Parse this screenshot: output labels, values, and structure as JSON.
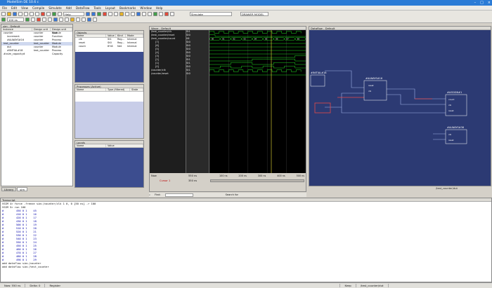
{
  "window": {
    "title": "ModelSim DE 10.6 c",
    "controls": [
      "–",
      "□",
      "×"
    ]
  },
  "menu": [
    "File",
    "Edit",
    "View",
    "Compile",
    "Simulate",
    "Add",
    "DataFlow",
    "Tools",
    "Layout",
    "Bookmarks",
    "Window",
    "Help"
  ],
  "toolbar": {
    "help_combo": "Help",
    "layout_combo": "Simulate",
    "time_field": "100 ns",
    "combo_right": "DRAWER MODEL"
  },
  "sim_panel": {
    "title": "sim - Default",
    "columns": [
      "Instance",
      "Design unit",
      "Design unit type"
    ],
    "rows": [
      {
        "name": "counter",
        "unit": "counter",
        "type": "Module"
      },
      {
        "name": "increment",
        "unit": "counter",
        "type": "Function"
      },
      {
        "name": "#ALWAYS#16",
        "unit": "counter",
        "type": "Process"
      },
      {
        "name": "test_counter",
        "unit": "test_counter",
        "type": "Module"
      },
      {
        "name": "dut",
        "unit": "counter",
        "type": "Module"
      },
      {
        "name": "#INITIAL#18",
        "unit": "test_counter",
        "type": "Process"
      },
      {
        "name": "#vsim_capacity#",
        "unit": "",
        "type": "Capacity"
      }
    ],
    "tabs": [
      "Library",
      "sim"
    ]
  },
  "objects_panel": {
    "title": "Objects",
    "columns": [
      "Name",
      "Value",
      "Kind",
      "Mode"
    ],
    "rows": [
      {
        "name": "clk",
        "value": "St1",
        "kind": "Reg...",
        "mode": "Internal"
      },
      {
        "name": "reset",
        "value": "St0",
        "kind": "Reg...",
        "mode": "Internal"
      },
      {
        "name": "count",
        "value": "8'h6",
        "kind": "Net",
        "mode": "Internal"
      }
    ]
  },
  "processes_panel": {
    "title": "Processes (Active)",
    "columns": [
      "Name",
      "Type (filtered)",
      "State"
    ]
  },
  "locals_panel": {
    "title": "Locals",
    "columns": [
      "Name",
      "Value"
    ]
  },
  "wave_panel": {
    "title": "Wave - Default",
    "signals": [
      {
        "name": "/test_counter/clk",
        "value": "St1"
      },
      {
        "name": "/test_counter/reset",
        "value": "St0"
      },
      {
        "name": "/test_counter/count",
        "value": "06"
      },
      {
        "name": "[7]",
        "value": "St0"
      },
      {
        "name": "[6]",
        "value": "St0"
      },
      {
        "name": "[5]",
        "value": "St0"
      },
      {
        "name": "[4]",
        "value": "St0"
      },
      {
        "name": "[3]",
        "value": "St0"
      },
      {
        "name": "[2]",
        "value": "St1"
      },
      {
        "name": "[1]",
        "value": "St1"
      },
      {
        "name": "[0]",
        "value": "St0"
      },
      {
        "name": "/counter/clk",
        "value": "St1"
      },
      {
        "name": "/counter/reset",
        "value": "St0"
      }
    ],
    "bus_values": [
      "00",
      "01",
      "02",
      "03",
      "04",
      "05",
      "06",
      "07",
      "08"
    ],
    "now_label": "Now",
    "now_value": "550 ns",
    "cursor_label": "Cursor 1",
    "cursor_value": "350 ns",
    "timeline": [
      "100 ns",
      "200 ns",
      "300 ns",
      "400 ns",
      "500 ns"
    ],
    "find_label": "Find:",
    "search_label": "Search for"
  },
  "dataflow_panel": {
    "title": "Dataflow - Default",
    "blocks": [
      {
        "title": "#INITIAL#18",
        "ports": []
      },
      {
        "title": "#ALWAYS#16",
        "ports": [
          "reset",
          "clk"
        ]
      },
      {
        "title": "#ASSIGN#1",
        "ports": [
          "count",
          "clk",
          "reset"
        ]
      },
      {
        "title": "#ALWAYS#36",
        "ports": [
          "clk",
          "reset"
        ]
      }
    ],
    "instance_label": "/test_counter/dut"
  },
  "transcript": {
    "title": "Transcript",
    "lines": [
      "VSIM 4> force -freeze sim:/counter/clk 1 0, 0 {50 ns} -r 100",
      "VSIM 5> run 100",
      "#        450 0 1    45",
      "#        410 0 1    16",
      "#        420 0 1    17",
      "#        430 0 1    18",
      "#        500 0 1    19",
      "#        510 0 1    20",
      "#        520 0 1    21",
      "#        530 0 1    22",
      "#        540 0 1    23",
      "#        550 0 1    24",
      "#        450 0 1    25",
      "#        460 0 1    26",
      "#        470 0 1    27",
      "#        480 0 1    28",
      "#        490 0 1    29",
      "add dataflow sim:/counter",
      "add dataflow sim:/test_counter"
    ]
  },
  "statusbar": {
    "now": "Now: 550 ns",
    "delta": "Delta: 0",
    "region": "Register",
    "keep": "Keep",
    "path": "/test_counter/dut"
  },
  "colors": {
    "titlebar": "#2b7bd6",
    "wave_bg": "#000000",
    "wave_green": "#22dd22",
    "dataflow_bg": "#2c3a73",
    "panel_blue": "#3c4d8f"
  }
}
